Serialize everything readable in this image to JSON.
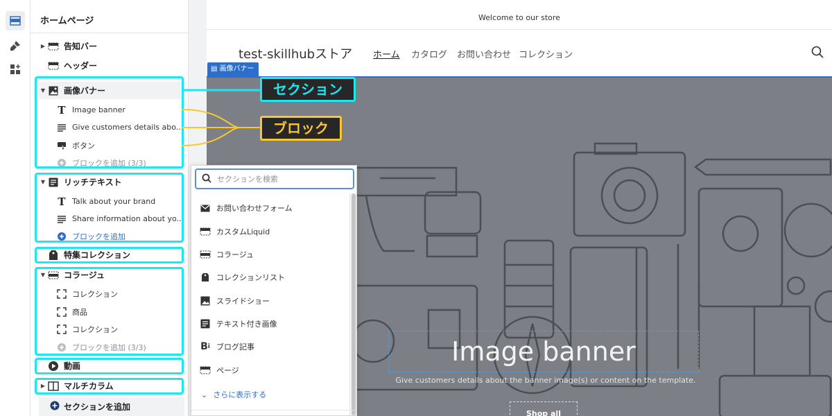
{
  "sidebar": {
    "title": "ホームページ",
    "sections": {
      "announcement": "告知バー",
      "header": "ヘッダー",
      "image_banner": "画像バナー",
      "rich_text": "リッチテキスト",
      "featured_collection": "特集コレクション",
      "collage": "コラージュ",
      "video": "動画",
      "multicolumn": "マルチカラム"
    },
    "image_banner_blocks": [
      "Image banner",
      "Give customers details abo...",
      "ボタン"
    ],
    "image_banner_add_block": "ブロックを追加 (3/3)",
    "rich_text_blocks": [
      "Talk about your brand",
      "Share information about yo..."
    ],
    "rich_text_add_block": "ブロックを追加",
    "collage_blocks": [
      "コレクション",
      "商品",
      "コレクション"
    ],
    "collage_add_block": "ブロックを追加 (3/3)",
    "add_section": "セクションを追加"
  },
  "preview": {
    "announcement": "Welcome to our store",
    "store_name": "test-skillhubストア",
    "nav": [
      "ホーム",
      "カタログ",
      "お問い合わせ",
      "コレクション"
    ],
    "banner_tag": "画像バナー",
    "banner_heading": "Image banner",
    "banner_text": "Give customers details about the banner image(s) or content on the template.",
    "banner_button": "Shop all"
  },
  "popup": {
    "search_placeholder": "セクションを検索",
    "items": [
      "お問い合わせフォーム",
      "カスタムLiquid",
      "コラージュ",
      "コレクションリスト",
      "スライドショー",
      "テキスト付き画像",
      "ブログ記事",
      "ページ"
    ],
    "show_more": "さらに表示する"
  },
  "callouts": {
    "section": "セクション",
    "block": "ブロック"
  },
  "colors": {
    "highlight_cyan": "#1ee6f0",
    "highlight_yellow": "#f7c634",
    "accent_blue": "#2c6ecb"
  }
}
